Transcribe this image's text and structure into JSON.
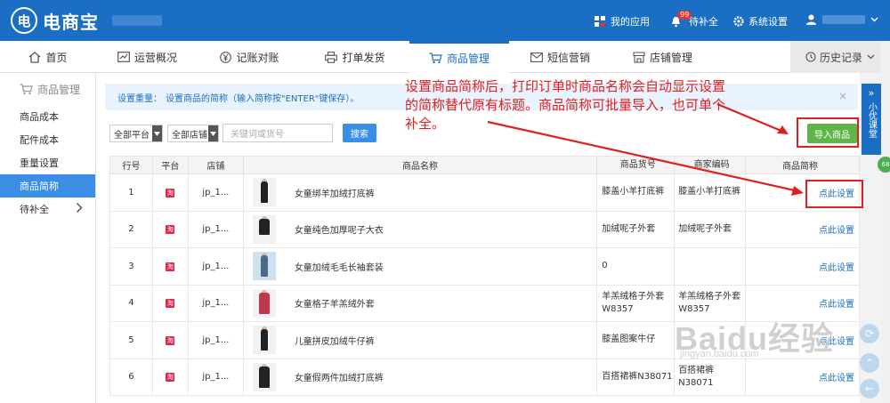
{
  "app": {
    "logo_text": "电商宝",
    "logo_mark": "电"
  },
  "header": {
    "my_apps": "我的应用",
    "pending": "待补全",
    "pending_badge": "99",
    "settings": "系统设置"
  },
  "nav": {
    "tabs": [
      {
        "label": "首页",
        "icon": "home-icon"
      },
      {
        "label": "运营概况",
        "icon": "chart-icon"
      },
      {
        "label": "记账对账",
        "icon": "yen-icon"
      },
      {
        "label": "打单发货",
        "icon": "printer-icon"
      },
      {
        "label": "商品管理",
        "icon": "cart-icon",
        "active": true
      },
      {
        "label": "短信营销",
        "icon": "mail-icon"
      },
      {
        "label": "店铺管理",
        "icon": "shop-icon"
      }
    ],
    "history": "历史记录"
  },
  "sidebar": {
    "title": "商品管理",
    "items": [
      {
        "label": "商品成本"
      },
      {
        "label": "配件成本"
      },
      {
        "label": "重量设置"
      },
      {
        "label": "商品简称",
        "active": true
      },
      {
        "label": "待补全"
      }
    ]
  },
  "tip": {
    "prefix": "设置重量：",
    "text": "设置商品的简称（输入简称按\"ENTER\"键保存）。",
    "close": "×"
  },
  "filters": {
    "platform": "全部平台",
    "shop": "全部店铺",
    "search_placeholder": "关键词或货号",
    "search_button": "搜索",
    "import_button": "导入商品"
  },
  "table": {
    "headers": [
      "行号",
      "平台",
      "店铺",
      "商品名称",
      "商品货号",
      "商家编码",
      "商品简称"
    ],
    "platform_glyph": "淘",
    "rows": [
      {
        "idx": "1",
        "shop": "jp_1...",
        "name": "女童绑羊加绒打底裤",
        "item_no": "膝盖小羊打底裤",
        "code": "膝盖小羊打底裤",
        "action": "点此设置"
      },
      {
        "idx": "2",
        "shop": "jp_1...",
        "name": "女童纯色加厚呢子大衣",
        "item_no": "加绒呢子外套",
        "code": "加绒呢子外套",
        "action": "点此设置"
      },
      {
        "idx": "3",
        "shop": "jp_1...",
        "name": "女童加绒毛毛长袖套装",
        "item_no": "0",
        "code": "",
        "action": "点此设置"
      },
      {
        "idx": "4",
        "shop": "jp_1...",
        "name": "女童格子羊羔绒外套",
        "item_no": "羊羔绒格子外套 W8357",
        "code": "羊羔绒格子外套 W8357",
        "action": "点此设置"
      },
      {
        "idx": "5",
        "shop": "jp_1...",
        "name": "儿童拼皮加绒牛仔裤",
        "item_no": "膝盖图案牛仔",
        "code": "",
        "action": "点此设置"
      },
      {
        "idx": "6",
        "shop": "jp_1...",
        "name": "女童假两件加绒打底裤",
        "item_no": "百搭裙裤N38071",
        "code": "百搭裙裤N38071",
        "action": "点此设置"
      }
    ]
  },
  "annotation": {
    "text": "设置商品简称后，打印订单时商品名称会自动显示设置的简称替代原有标题。商品简称可批量导入，也可单个补全。",
    "color": "#e02020"
  },
  "side_float": {
    "label": "小优课堂",
    "badge": "68"
  },
  "watermark": {
    "big": "Baidu经验",
    "small": "jingyan.baidu.com"
  },
  "colors": {
    "brand": "#1a6fc4",
    "import_green": "#5fb548",
    "annotation_red": "#e02020"
  }
}
